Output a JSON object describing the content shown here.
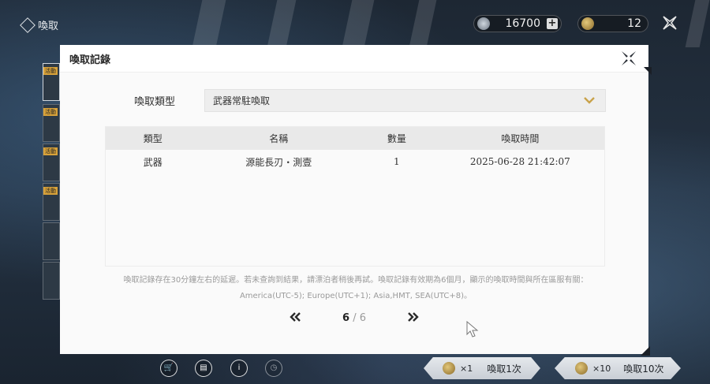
{
  "top": {
    "title": "喚取",
    "currency_1_value": "16700",
    "currency_2_value": "12"
  },
  "side_rail": {
    "tag": "活動"
  },
  "modal": {
    "title": "喚取記錄",
    "type_label": "喚取類型",
    "type_value": "武器常駐喚取",
    "table": {
      "headers": [
        "類型",
        "名稱",
        "數量",
        "喚取時間"
      ],
      "rows": [
        [
          "武器",
          "源能長刃・測壹",
          "1",
          "2025-06-28 21:42:07"
        ]
      ]
    },
    "note_line1": "喚取記錄存在30分鐘左右的延遲。若未查詢到結果，請漂泊者稍後再試。喚取記錄有效期為6個月，顯示的喚取時間與所在區服有關：",
    "note_line2": "America(UTC-5); Europe(UTC+1); Asia,HMT, SEA(UTC+8)。",
    "pagination": {
      "current": "6",
      "separator": "/",
      "total": "6"
    }
  },
  "bottom": {
    "pull_1_cost": "×1",
    "pull_1_label": "喚取1次",
    "pull_10_cost": "×10",
    "pull_10_label": "喚取10次"
  },
  "colors": {
    "modal_bg": "#fafafa",
    "header_row_bg": "#e9e9e9",
    "chevron": "#c9a24a",
    "note_text": "#9a9a9a"
  }
}
